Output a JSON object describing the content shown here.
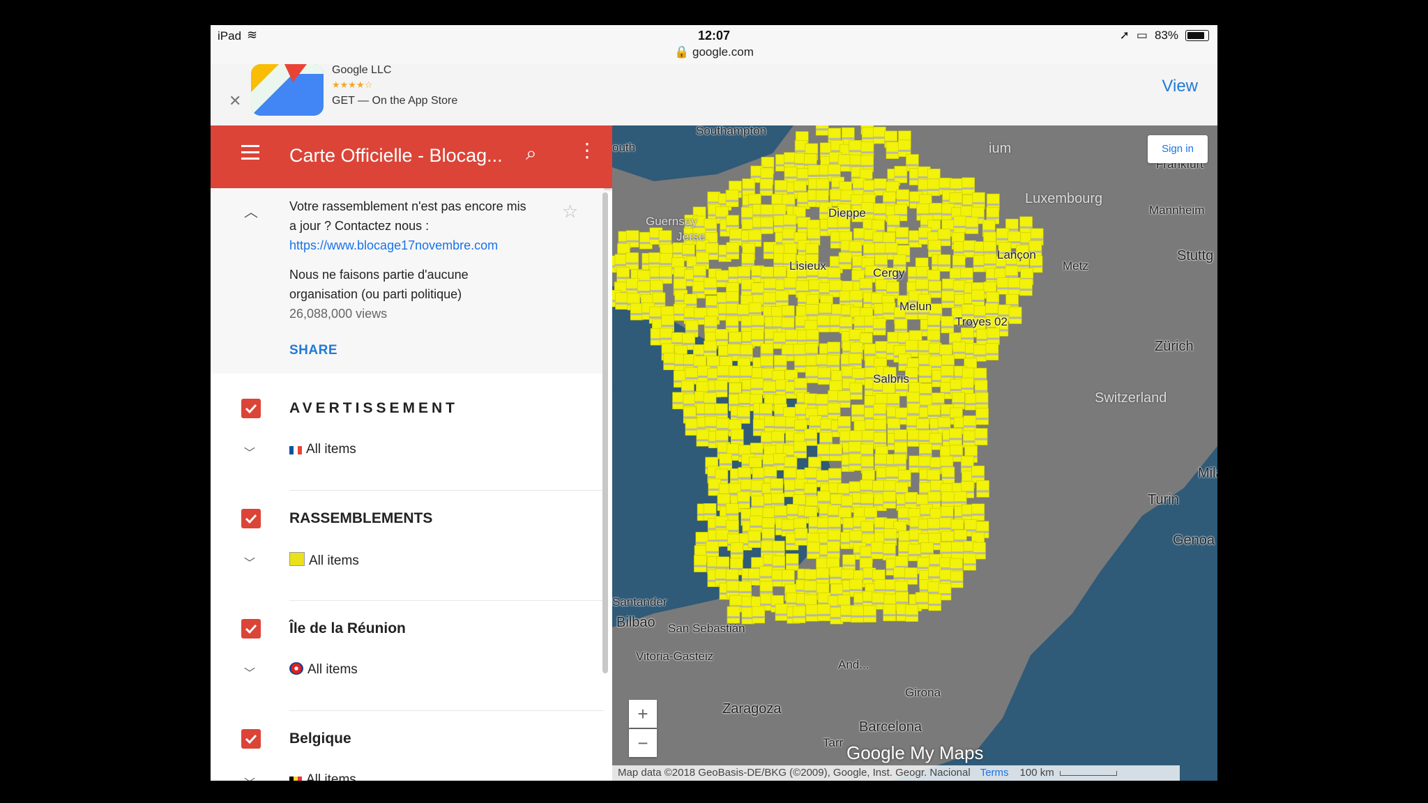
{
  "status": {
    "device": "iPad",
    "time": "12:07",
    "url": "google.com",
    "battery": "83%"
  },
  "banner": {
    "publisher": "Google LLC",
    "stars": "★★★★☆",
    "get": "GET — On the App Store",
    "view": "View"
  },
  "app": {
    "title": "Carte Officielle - Blocag..."
  },
  "description": {
    "line1": "Votre rassemblement n'est pas encore mis a jour ? Contactez nous :",
    "link": "https://www.blocage17novembre.com",
    "line2": "Nous ne faisons partie d'aucune organisation (ou parti politique)",
    "views": "26,088,000 views",
    "share": "SHARE"
  },
  "layers": [
    {
      "name": "AVERTISSEMENT",
      "items": "All items",
      "icon": "france-flag-icon"
    },
    {
      "name": "RASSEMBLEMENTS",
      "items": "All items",
      "icon": "yellow-vest-icon"
    },
    {
      "name": "Île de la Réunion",
      "items": "All items",
      "icon": "reunion-flag-icon"
    },
    {
      "name": "Belgique",
      "items": "All items",
      "icon": "belgium-flag-icon"
    }
  ],
  "map": {
    "signin": "Sign in",
    "zoom_in": "+",
    "zoom_out": "−",
    "brand": "Google My Maps",
    "attribution": "Map data ©2018 GeoBasis-DE/BKG (©2009), Google, Inst. Geogr. Nacional",
    "terms": "Terms",
    "scale": "100 km",
    "labels": {
      "southampton": "Southampton",
      "south": "outh",
      "guernsey": "Guernsey",
      "jersey": "Jerse",
      "belgium": "ium",
      "frankfurt": "Frankfurt",
      "luxembourg": "Luxembourg",
      "mannheim": "Mannheim",
      "stuttgart": "Stuttg",
      "dieppe": "Dieppe",
      "lisieux": "Lisieux",
      "cergy": "Cergy",
      "lancon": "Lançon",
      "metz": "Metz",
      "melun": "Melun",
      "troyes": "Troyes 02",
      "zurich": "Zürich",
      "switzerland": "Switzerland",
      "salbris": "Salbris",
      "milan": "Mila",
      "turin": "Turin",
      "genoa": "Genoa",
      "santander": "Santander",
      "bilbao": "Bilbao",
      "sansebastian": "San Sebastián",
      "vitoria": "Vitoria-Gasteiz",
      "andorra": "And...",
      "zaragoza": "Zaragoza",
      "barcelona": "Barcelona",
      "girona": "Girona",
      "tarragona": "Tarr"
    }
  },
  "colors": {
    "accent": "#db4437",
    "link": "#1a73e8",
    "sea": "#2f5a78",
    "land": "#7a7a7a",
    "vest": "#f2f20a"
  }
}
